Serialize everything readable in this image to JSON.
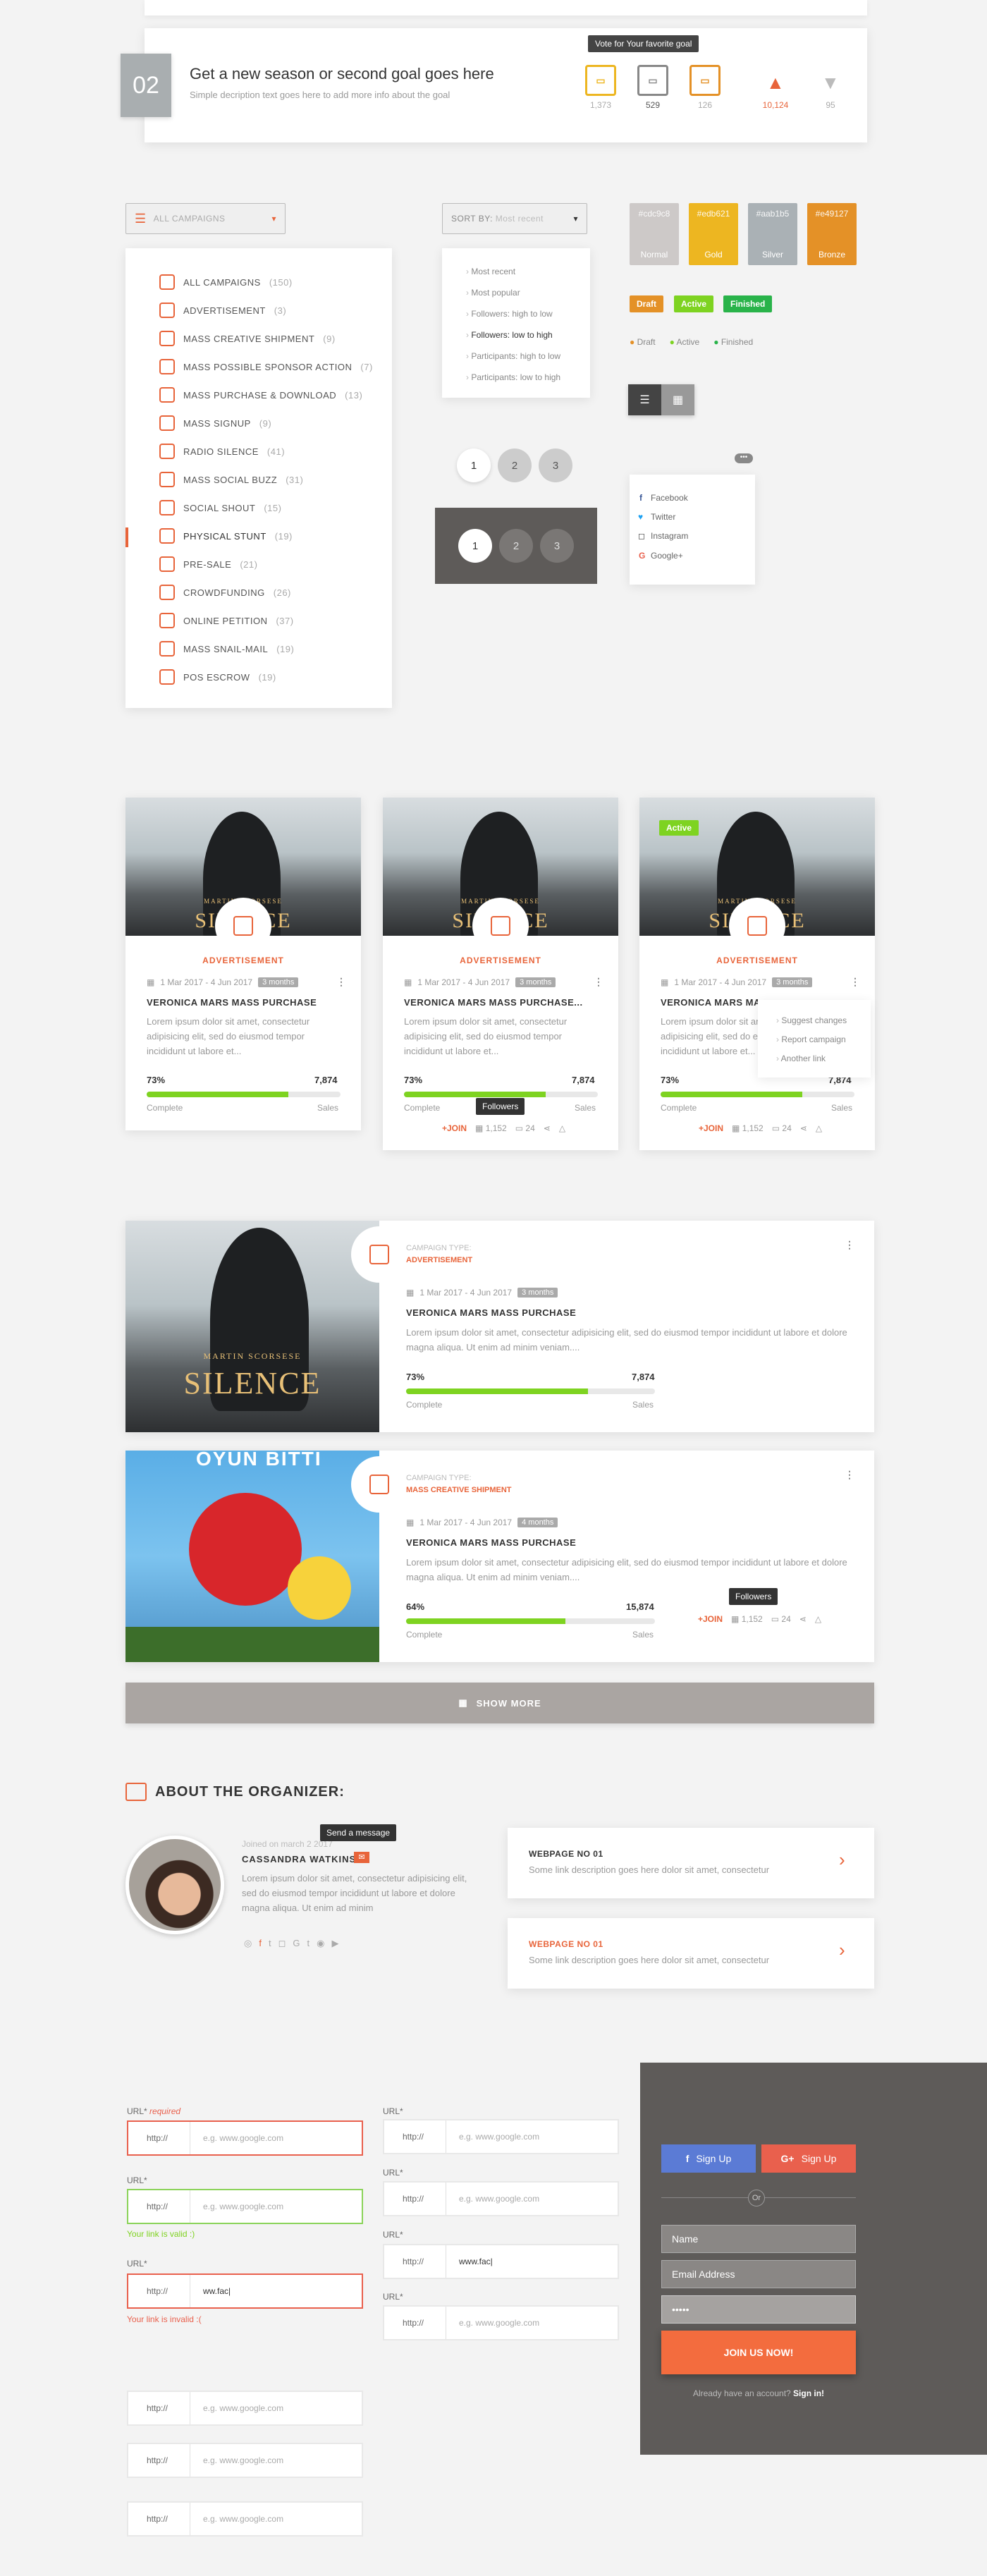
{
  "goal": {
    "number": "02",
    "title": "Get a new season or second goal goes here",
    "subtitle": "Simple decription text goes here to add more info about the goal",
    "tooltip": "Vote for Your favorite goal",
    "votes": [
      "1,373",
      "529",
      "126"
    ],
    "likes": "10,124",
    "dislikes": "95"
  },
  "campaigns_btn": "ALL CAMPAIGNS",
  "sort": {
    "label": "SORT BY:",
    "value": "Most recent",
    "options": [
      "Most recent",
      "Most popular",
      "Followers: high to low",
      "Followers: low to high",
      "Participants: high to low",
      "Participants: low to high"
    ]
  },
  "menu": {
    "items": [
      {
        "label": "ALL CAMPAIGNS",
        "count": "(150)"
      },
      {
        "label": "ADVERTISEMENT",
        "count": "(3)"
      },
      {
        "label": "MASS CREATIVE SHIPMENT",
        "count": "(9)"
      },
      {
        "label": "MASS POSSIBLE SPONSOR ACTION",
        "count": "(7)"
      },
      {
        "label": "MASS PURCHASE & DOWNLOAD",
        "count": "(13)"
      },
      {
        "label": "MASS SIGNUP",
        "count": "(9)"
      },
      {
        "label": "RADIO SILENCE",
        "count": "(41)"
      },
      {
        "label": "MASS SOCIAL BUZZ",
        "count": "(31)"
      },
      {
        "label": "SOCIAL SHOUT",
        "count": "(15)"
      },
      {
        "label": "PHYSICAL STUNT",
        "count": "(19)"
      },
      {
        "label": "PRE-SALE",
        "count": "(21)"
      },
      {
        "label": "CROWDFUNDING",
        "count": "(26)"
      },
      {
        "label": "ONLINE PETITION",
        "count": "(37)"
      },
      {
        "label": "MASS SNAIL-MAIL",
        "count": "(19)"
      },
      {
        "label": "POS ESCROW",
        "count": "(19)"
      }
    ]
  },
  "swatches": [
    {
      "hex": "#cdc9c8",
      "name": "Normal",
      "color": "#cdc9c8"
    },
    {
      "hex": "#edb621",
      "name": "Gold",
      "color": "#edb621"
    },
    {
      "hex": "#aab1b5",
      "name": "Silver",
      "color": "#aab1b5"
    },
    {
      "hex": "#e49127",
      "name": "Bronze",
      "color": "#e49127"
    }
  ],
  "badges": {
    "draft": "Draft",
    "active": "Active",
    "finished": "Finished"
  },
  "pagination": [
    "1",
    "2",
    "3"
  ],
  "social": [
    "Facebook",
    "Twitter",
    "Instagram",
    "Google+"
  ],
  "card": {
    "category": "ADVERTISEMENT",
    "dates": "1 Mar 2017 - 4 Jun 2017",
    "duration": "3 months",
    "title": "VERONICA MARS MASS PURCHASE",
    "title_trunc": "VERONICA MARS MASS PURCHASE...",
    "title_trunc2": "VERONICA MARS MA",
    "desc": "Lorem ipsum dolor sit amet, consectetur adipisicing elit, sed do eiusmod tempor incididunt ut labore et...",
    "pct": "73%",
    "sales": "7,874",
    "complete": "Complete",
    "sales_label": "Sales",
    "join": "+JOIN",
    "followers": "1,152",
    "comments": "24",
    "tooltip": "Followers",
    "active": "Active",
    "poster_top": "MARTIN SCORSESE",
    "poster_sub": "SILENCE",
    "context": [
      "Suggest changes",
      "Report campaign",
      "Another link"
    ]
  },
  "wide": [
    {
      "type_label": "CAMPAIGN TYPE:",
      "type": "ADVERTISEMENT",
      "dates": "1 Mar 2017 - 4 Jun 2017",
      "duration": "3 months",
      "title": "VERONICA MARS MASS PURCHASE",
      "desc": "Lorem ipsum dolor sit amet, consectetur adipisicing elit, sed do eiusmod tempor incididunt ut labore et dolore magna aliqua. Ut enim ad minim veniam....",
      "pct": "73%",
      "sales": "7,874",
      "progress": 0.73
    },
    {
      "type_label": "CAMPAIGN TYPE:",
      "type": "MASS CREATIVE SHIPMENT",
      "dates": "1 Mar 2017 - 4 Jun 2017",
      "duration": "4 months",
      "title": "VERONICA MARS MASS PURCHASE",
      "desc": "Lorem ipsum dolor sit amet, consectetur adipisicing elit, sed do eiusmod tempor incididunt ut labore et dolore magna aliqua. Ut enim ad minim veniam....",
      "pct": "64%",
      "sales": "15,874",
      "progress": 0.64,
      "banner": "OYUN BITTI"
    }
  ],
  "show_more": "SHOW MORE",
  "organizer": {
    "heading": "ABOUT THE ORGANIZER:",
    "joined": "Joined on march 2 2017",
    "name": "CASSANDRA WATKINS",
    "tooltip": "Send a message",
    "bio": "Lorem ipsum dolor sit amet, consectetur adipisicing elit, sed do eiusmod tempor incididunt ut labore et dolore magna aliqua. Ut enim ad minim",
    "links": [
      {
        "title": "WEBPAGE NO 01",
        "desc": "Some link description goes here dolor sit amet, consectetur"
      },
      {
        "title": "WEBPAGE NO 01",
        "desc": "Some link description goes here dolor sit amet, consectetur"
      }
    ]
  },
  "forms": {
    "url_label": "URL*",
    "required": "required",
    "prefix": "http://",
    "placeholder": "e.g. www.google.com",
    "typed": "ww.fac|",
    "typed2": "www.fac|",
    "valid_msg": "Your link is valid :)",
    "invalid_msg": "Your link is invalid :("
  },
  "signup": {
    "facebook": "Sign Up",
    "google": "Sign Up",
    "or": "Or",
    "name": "Name",
    "email": "Email Address",
    "password": "•••••",
    "join": "JOIN US NOW!",
    "already": "Already have an account?",
    "signin": "Sign in!"
  },
  "colors": {
    "accent": "#e8643a",
    "green": "#7ed321",
    "dark_panel": "#5e5b59",
    "facebook": "#5b7bd5",
    "google": "#e9604d"
  }
}
